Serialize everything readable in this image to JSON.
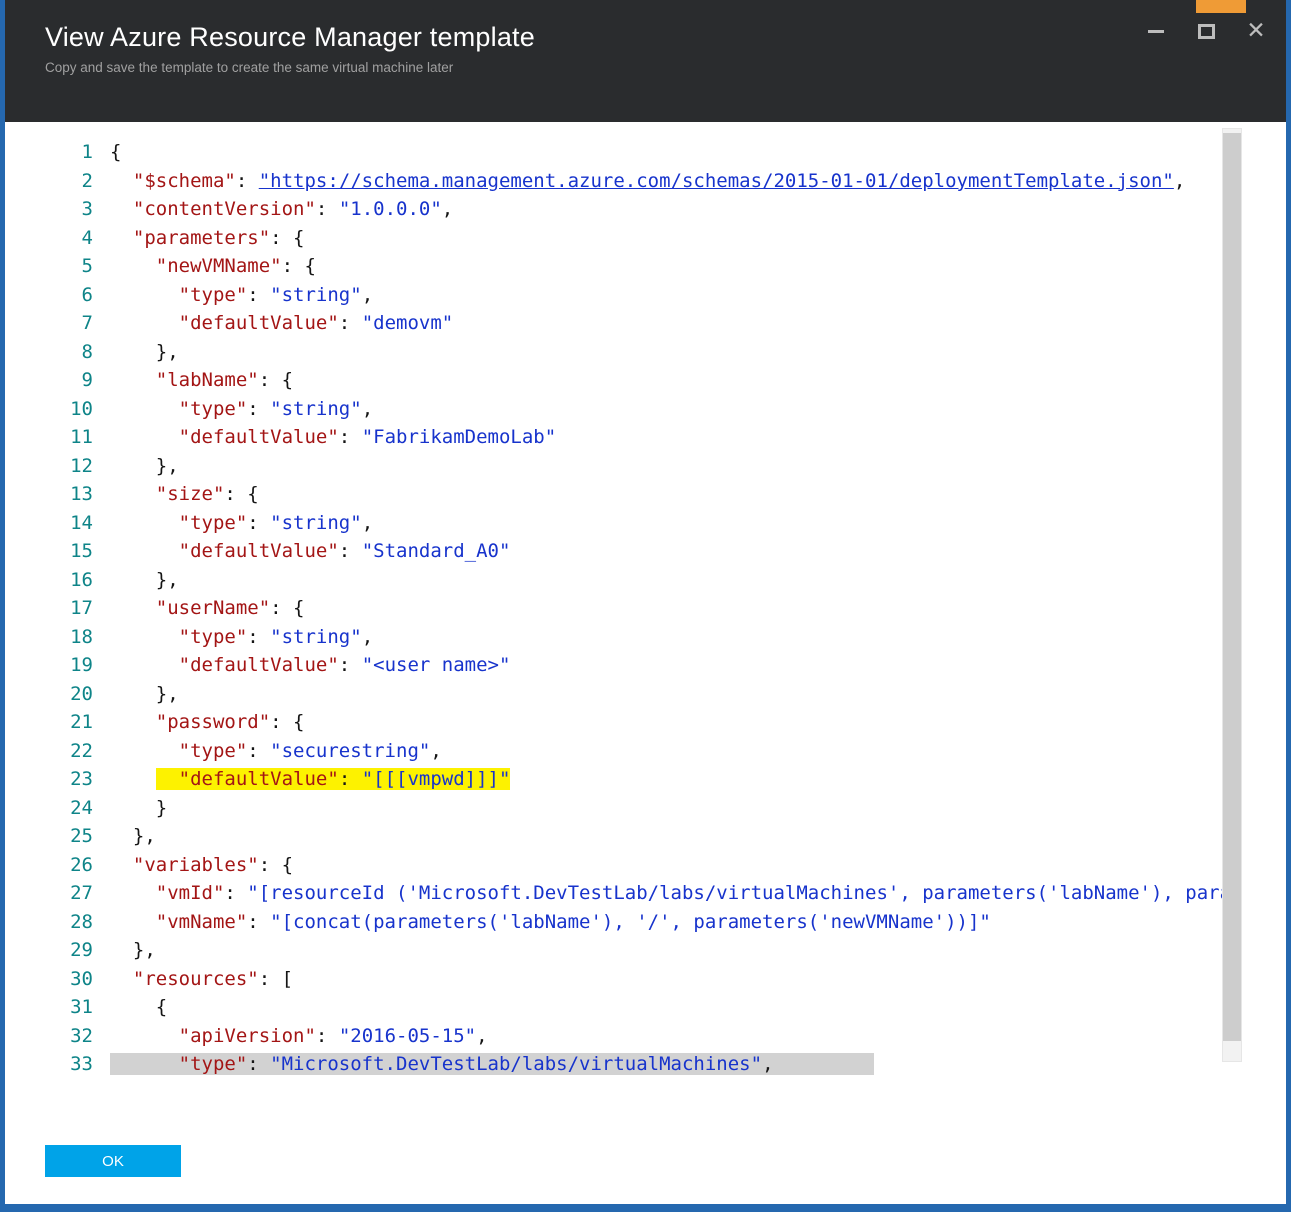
{
  "dialog": {
    "title": "View Azure Resource Manager template",
    "subtitle": "Copy and save the template to create the same virtual machine later"
  },
  "icons": {
    "close": "✕",
    "minimize": "minimize-bar",
    "maximize": "maximize-box"
  },
  "footer": {
    "ok_label": "OK"
  },
  "colors": {
    "border_blue": "#2568af",
    "titlebar_bg": "#2a2c2e",
    "accent_orange": "#ef9b36",
    "key": "#a31515",
    "value": "#1733cc",
    "punct": "#151515",
    "line_number": "#0e8488",
    "highlight_yellow": "#fdf200",
    "selection_gray": "#d2d2d2",
    "ok_button": "#00a3e8"
  },
  "code": {
    "lines": [
      {
        "no": 1,
        "tokens": [
          [
            "p",
            "{"
          ]
        ]
      },
      {
        "no": 2,
        "tokens": [
          [
            "p",
            "  "
          ],
          [
            "k",
            "\"$schema\""
          ],
          [
            "p",
            ": "
          ],
          [
            "l",
            "\"https://schema.management.azure.com/schemas/2015-01-01/deploymentTemplate.json\""
          ],
          [
            "p",
            ","
          ]
        ]
      },
      {
        "no": 3,
        "tokens": [
          [
            "p",
            "  "
          ],
          [
            "k",
            "\"contentVersion\""
          ],
          [
            "p",
            ": "
          ],
          [
            "s",
            "\"1.0.0.0\""
          ],
          [
            "p",
            ","
          ]
        ]
      },
      {
        "no": 4,
        "tokens": [
          [
            "p",
            "  "
          ],
          [
            "k",
            "\"parameters\""
          ],
          [
            "p",
            ": {"
          ]
        ]
      },
      {
        "no": 5,
        "tokens": [
          [
            "p",
            "    "
          ],
          [
            "k",
            "\"newVMName\""
          ],
          [
            "p",
            ": {"
          ]
        ]
      },
      {
        "no": 6,
        "tokens": [
          [
            "p",
            "      "
          ],
          [
            "k",
            "\"type\""
          ],
          [
            "p",
            ": "
          ],
          [
            "s",
            "\"string\""
          ],
          [
            "p",
            ","
          ]
        ]
      },
      {
        "no": 7,
        "tokens": [
          [
            "p",
            "      "
          ],
          [
            "k",
            "\"defaultValue\""
          ],
          [
            "p",
            ": "
          ],
          [
            "s",
            "\"demovm\""
          ]
        ]
      },
      {
        "no": 8,
        "tokens": [
          [
            "p",
            "    },"
          ]
        ]
      },
      {
        "no": 9,
        "tokens": [
          [
            "p",
            "    "
          ],
          [
            "k",
            "\"labName\""
          ],
          [
            "p",
            ": {"
          ]
        ]
      },
      {
        "no": 10,
        "tokens": [
          [
            "p",
            "      "
          ],
          [
            "k",
            "\"type\""
          ],
          [
            "p",
            ": "
          ],
          [
            "s",
            "\"string\""
          ],
          [
            "p",
            ","
          ]
        ]
      },
      {
        "no": 11,
        "tokens": [
          [
            "p",
            "      "
          ],
          [
            "k",
            "\"defaultValue\""
          ],
          [
            "p",
            ": "
          ],
          [
            "s",
            "\"FabrikamDemoLab\""
          ]
        ]
      },
      {
        "no": 12,
        "tokens": [
          [
            "p",
            "    },"
          ]
        ]
      },
      {
        "no": 13,
        "tokens": [
          [
            "p",
            "    "
          ],
          [
            "k",
            "\"size\""
          ],
          [
            "p",
            ": {"
          ]
        ]
      },
      {
        "no": 14,
        "tokens": [
          [
            "p",
            "      "
          ],
          [
            "k",
            "\"type\""
          ],
          [
            "p",
            ": "
          ],
          [
            "s",
            "\"string\""
          ],
          [
            "p",
            ","
          ]
        ]
      },
      {
        "no": 15,
        "tokens": [
          [
            "p",
            "      "
          ],
          [
            "k",
            "\"defaultValue\""
          ],
          [
            "p",
            ": "
          ],
          [
            "s",
            "\"Standard_A0\""
          ]
        ]
      },
      {
        "no": 16,
        "tokens": [
          [
            "p",
            "    },"
          ]
        ]
      },
      {
        "no": 17,
        "tokens": [
          [
            "p",
            "    "
          ],
          [
            "k",
            "\"userName\""
          ],
          [
            "p",
            ": {"
          ]
        ]
      },
      {
        "no": 18,
        "tokens": [
          [
            "p",
            "      "
          ],
          [
            "k",
            "\"type\""
          ],
          [
            "p",
            ": "
          ],
          [
            "s",
            "\"string\""
          ],
          [
            "p",
            ","
          ]
        ]
      },
      {
        "no": 19,
        "tokens": [
          [
            "p",
            "      "
          ],
          [
            "k",
            "\"defaultValue\""
          ],
          [
            "p",
            ": "
          ],
          [
            "s",
            "\"<user name>\""
          ]
        ]
      },
      {
        "no": 20,
        "tokens": [
          [
            "p",
            "    },"
          ]
        ]
      },
      {
        "no": 21,
        "tokens": [
          [
            "p",
            "    "
          ],
          [
            "k",
            "\"password\""
          ],
          [
            "p",
            ": {"
          ]
        ]
      },
      {
        "no": 22,
        "tokens": [
          [
            "p",
            "      "
          ],
          [
            "k",
            "\"type\""
          ],
          [
            "p",
            ": "
          ],
          [
            "s",
            "\"securestring\""
          ],
          [
            "p",
            ","
          ]
        ]
      },
      {
        "no": 23,
        "tokens": [
          [
            "p",
            "    "
          ],
          [
            "p",
            "  ",
            "y"
          ],
          [
            "k",
            "\"defaultValue\"",
            "y"
          ],
          [
            "p",
            ": ",
            "y"
          ],
          [
            "s",
            "\"[[[vmpwd]]]\"",
            "y"
          ]
        ]
      },
      {
        "no": 24,
        "tokens": [
          [
            "p",
            "    }"
          ]
        ]
      },
      {
        "no": 25,
        "tokens": [
          [
            "p",
            "  },"
          ]
        ]
      },
      {
        "no": 26,
        "tokens": [
          [
            "p",
            "  "
          ],
          [
            "k",
            "\"variables\""
          ],
          [
            "p",
            ": {"
          ]
        ]
      },
      {
        "no": 27,
        "tokens": [
          [
            "p",
            "    "
          ],
          [
            "k",
            "\"vmId\""
          ],
          [
            "p",
            ": "
          ],
          [
            "s",
            "\"[resourceId ('Microsoft.DevTestLab/labs/virtualMachines', parameters('labName'), param"
          ]
        ]
      },
      {
        "no": 28,
        "tokens": [
          [
            "p",
            "    "
          ],
          [
            "k",
            "\"vmName\""
          ],
          [
            "p",
            ": "
          ],
          [
            "s",
            "\"[concat(parameters('labName'), '/', parameters('newVMName'))]\""
          ]
        ]
      },
      {
        "no": 29,
        "tokens": [
          [
            "p",
            "  },"
          ]
        ]
      },
      {
        "no": 30,
        "tokens": [
          [
            "p",
            "  "
          ],
          [
            "k",
            "\"resources\""
          ],
          [
            "p",
            ": ["
          ]
        ]
      },
      {
        "no": 31,
        "tokens": [
          [
            "p",
            "    {"
          ]
        ]
      },
      {
        "no": 32,
        "tokens": [
          [
            "p",
            "      "
          ],
          [
            "k",
            "\"apiVersion\""
          ],
          [
            "p",
            ": "
          ],
          [
            "s",
            "\"2016-05-15\""
          ],
          [
            "p",
            ","
          ]
        ]
      },
      {
        "no": 33,
        "sel": true,
        "tokens": [
          [
            "p",
            "      "
          ],
          [
            "k",
            "\"type\""
          ],
          [
            "p",
            ": "
          ],
          [
            "s",
            "\"Microsoft.DevTestLab/labs/virtualMachines\""
          ],
          [
            "p",
            ","
          ]
        ]
      }
    ]
  }
}
